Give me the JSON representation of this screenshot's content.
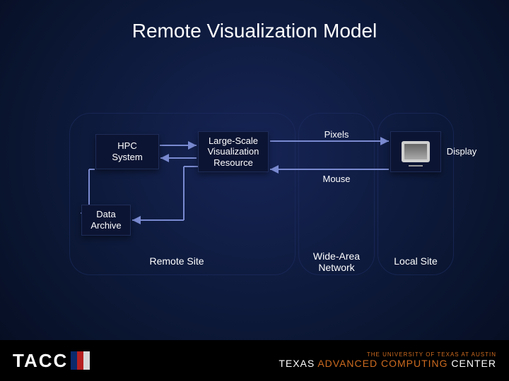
{
  "title": "Remote Visualization Model",
  "nodes": {
    "hpc": "HPC\nSystem",
    "vis": "Large-Scale\nVisualization\nResource",
    "archive": "Data\nArchive",
    "display": "Display"
  },
  "edge_labels": {
    "pixels": "Pixels",
    "mouse": "Mouse"
  },
  "regions": {
    "remote": "Remote Site",
    "network": "Wide-Area\nNetwork",
    "local": "Local Site"
  },
  "footer": {
    "logo_text": "TACC",
    "stripe_colors": [
      "#0a2a6c",
      "#b52020",
      "#d8d8d8"
    ],
    "ut_line": "THE UNIVERSITY OF TEXAS AT AUSTIN",
    "full_name_pre": "TEXAS ",
    "full_name_accent": "ADVANCED COMPUTING",
    "full_name_post": " CENTER"
  }
}
